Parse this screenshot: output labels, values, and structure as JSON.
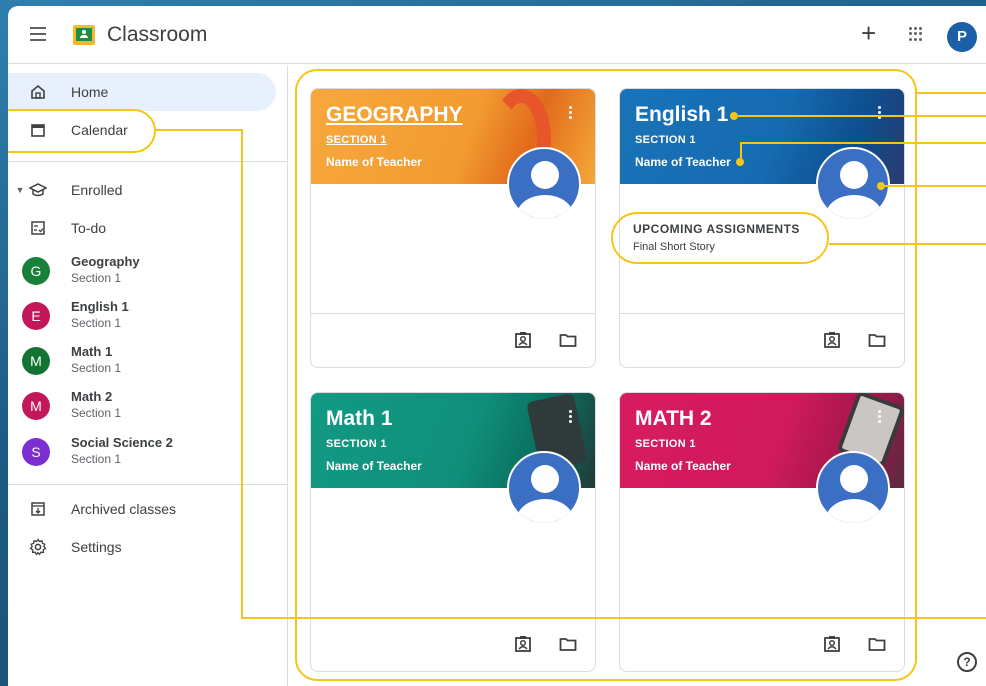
{
  "app": {
    "title": "Classroom",
    "avatar_letter": "P"
  },
  "sidebar": {
    "home": "Home",
    "calendar": "Calendar",
    "enrolled": "Enrolled",
    "todo": "To-do",
    "classes": [
      {
        "letter": "G",
        "name": "Geography",
        "section": "Section 1",
        "color": "#188038"
      },
      {
        "letter": "E",
        "name": "English 1",
        "section": "Section 1",
        "color": "#c2185b"
      },
      {
        "letter": "M",
        "name": "Math 1",
        "section": "Section 1",
        "color": "#137333"
      },
      {
        "letter": "M",
        "name": "Math 2",
        "section": "Section 1",
        "color": "#c2185b"
      },
      {
        "letter": "S",
        "name": "Social Science 2",
        "section": "Section 1",
        "color": "#7b2fd0"
      }
    ],
    "archived": "Archived classes",
    "settings": "Settings"
  },
  "cards": [
    {
      "title": "GEOGRAPHY",
      "section": "SECTION 1",
      "teacher": "Name of Teacher",
      "color": "#f6a83d"
    },
    {
      "title": "English 1",
      "section": "SECTION 1",
      "teacher": "Name of Teacher",
      "color": "#1a73b8",
      "upcoming_title": "UPCOMING ASSIGNMENTS",
      "upcoming_item": "Final Short Story"
    },
    {
      "title": "Math 1",
      "section": "SECTION 1",
      "teacher": "Name of Teacher",
      "color": "#129a84"
    },
    {
      "title": "MATH 2",
      "section": "SECTION 1",
      "teacher": "Name of Teacher",
      "color": "#d81b60"
    }
  ],
  "help_label": "?",
  "accent_colors": {
    "annotation": "#f5c518",
    "active_nav": "#e8f0fe"
  }
}
